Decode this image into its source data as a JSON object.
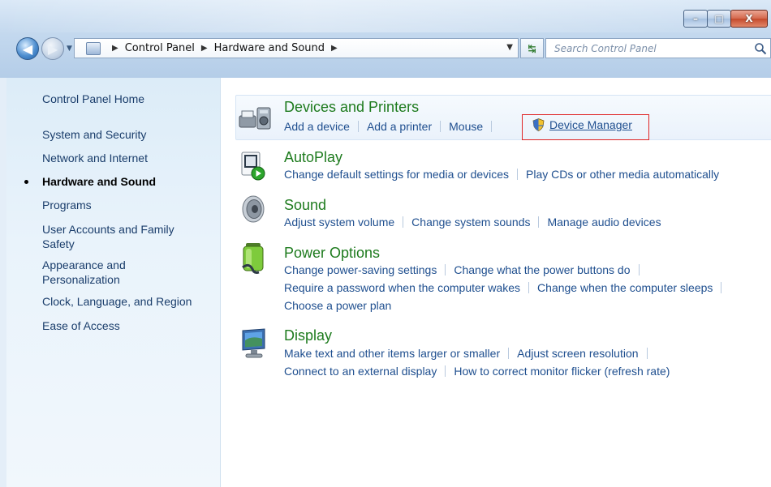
{
  "window": {
    "title_buttons": {
      "minimize": "–",
      "maximize": "□",
      "close": "X"
    }
  },
  "address_bar": {
    "crumbs": [
      "Control Panel",
      "Hardware and Sound"
    ],
    "search_placeholder": "Search Control Panel"
  },
  "sidebar": {
    "items": [
      {
        "label": "Control Panel Home"
      },
      {
        "label": "System and Security"
      },
      {
        "label": "Network and Internet"
      },
      {
        "label": "Hardware and Sound",
        "selected": true
      },
      {
        "label": "Programs"
      },
      {
        "label": "User Accounts and Family Safety"
      },
      {
        "label": "Appearance and Personalization"
      },
      {
        "label": "Clock, Language, and Region"
      },
      {
        "label": "Ease of Access"
      }
    ]
  },
  "categories": [
    {
      "title": "Devices and Printers",
      "icon": "printer-icon",
      "links": [
        "Add a device",
        "Add a printer",
        "Mouse"
      ],
      "extra_link": "Device Manager"
    },
    {
      "title": "AutoPlay",
      "icon": "autoplay-icon",
      "links": [
        "Change default settings for media or devices",
        "Play CDs or other media automatically"
      ]
    },
    {
      "title": "Sound",
      "icon": "speaker-icon",
      "links": [
        "Adjust system volume",
        "Change system sounds",
        "Manage audio devices"
      ]
    },
    {
      "title": "Power Options",
      "icon": "battery-icon",
      "links": [
        "Change power-saving settings",
        "Change what the power buttons do",
        "Require a password when the computer wakes",
        "Change when the computer sleeps",
        "Choose a power plan"
      ]
    },
    {
      "title": "Display",
      "icon": "monitor-icon",
      "links": [
        "Make text and other items larger or smaller",
        "Adjust screen resolution",
        "Connect to an external display",
        "How to correct monitor flicker (refresh rate)"
      ]
    }
  ],
  "colors": {
    "category_title": "#1e7b1e",
    "link": "#1f4f8f",
    "highlight_box": "#e02424"
  }
}
